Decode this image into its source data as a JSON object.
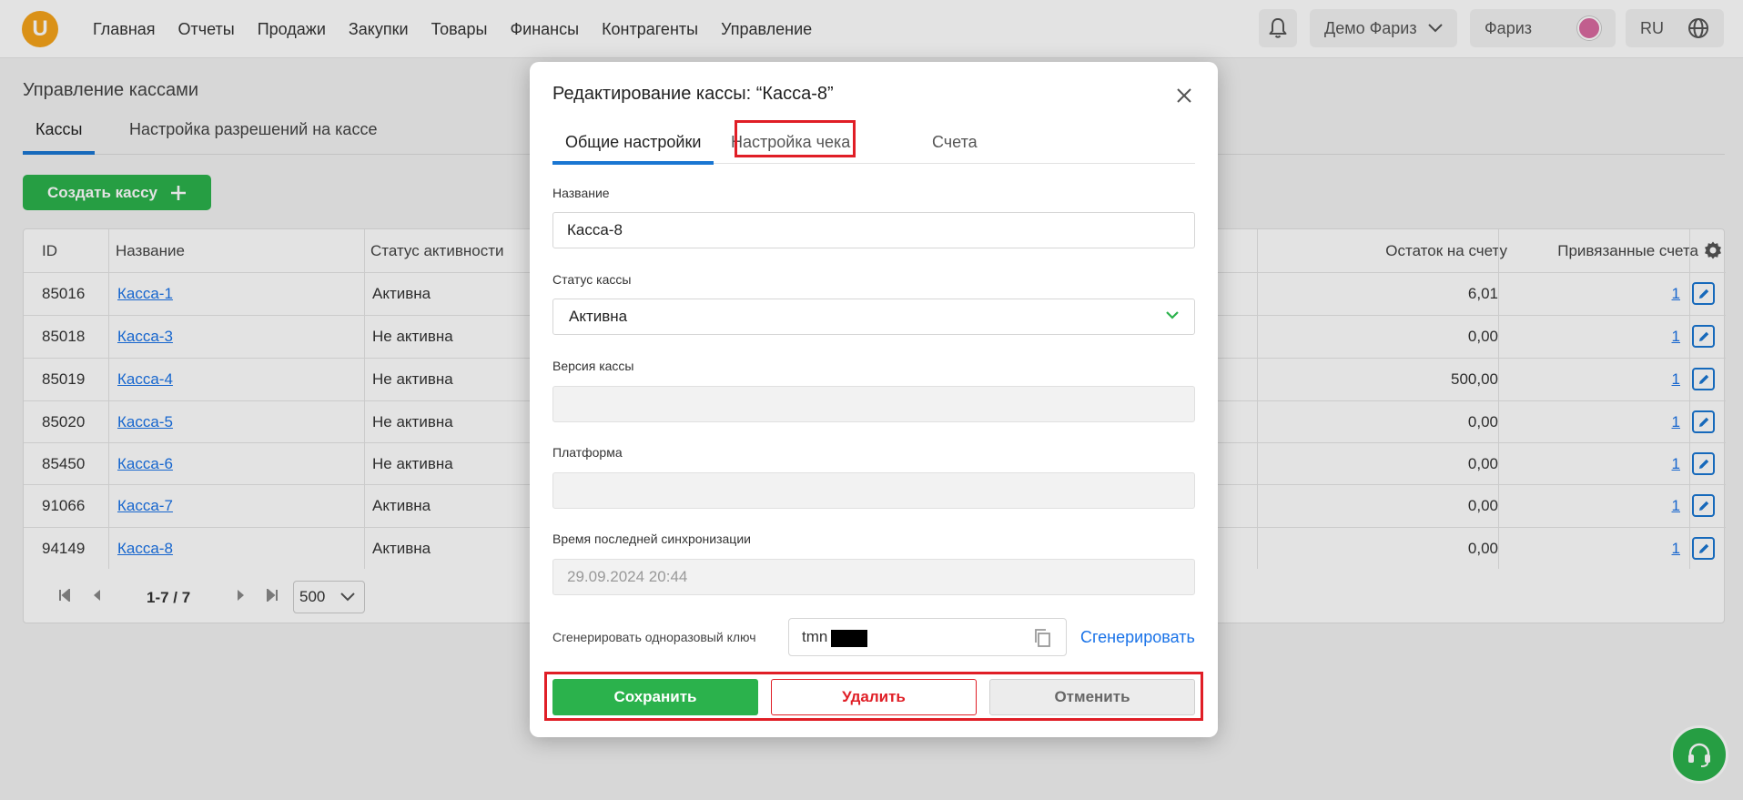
{
  "topbar": {
    "logo_letter": "U",
    "nav": [
      "Главная",
      "Отчеты",
      "Продажи",
      "Закупки",
      "Товары",
      "Финансы",
      "Контрагенты",
      "Управление"
    ],
    "company": "Демо Фариз",
    "user": "Фариз",
    "language": "RU"
  },
  "page": {
    "title": "Управление кассами",
    "tabs": [
      "Кассы",
      "Настройка разрешений на кассе"
    ],
    "create_button": "Создать кассу"
  },
  "table": {
    "headers": {
      "id": "ID",
      "name": "Название",
      "status": "Статус активности",
      "balance": "Остаток на счету",
      "accounts": "Привязанные счета"
    },
    "rows": [
      {
        "id": "85016",
        "name": "Касса-1",
        "status": "Активна",
        "balance": "6,01",
        "accounts": "1"
      },
      {
        "id": "85018",
        "name": "Касса-3",
        "status": "Не активна",
        "balance": "0,00",
        "accounts": "1"
      },
      {
        "id": "85019",
        "name": "Касса-4",
        "status": "Не активна",
        "balance": "500,00",
        "accounts": "1"
      },
      {
        "id": "85020",
        "name": "Касса-5",
        "status": "Не активна",
        "balance": "0,00",
        "accounts": "1"
      },
      {
        "id": "85450",
        "name": "Касса-6",
        "status": "Не активна",
        "balance": "0,00",
        "accounts": "1"
      },
      {
        "id": "91066",
        "name": "Касса-7",
        "status": "Активна",
        "balance": "0,00",
        "accounts": "1"
      },
      {
        "id": "94149",
        "name": "Касса-8",
        "status": "Активна",
        "balance": "0,00",
        "accounts": "1"
      }
    ],
    "pager": {
      "range": "1-7 / 7",
      "page_size": "500"
    }
  },
  "modal": {
    "title": "Редактирование кассы: “Касса-8”",
    "tabs": [
      "Общие настройки",
      "Настройка чека",
      "Счета"
    ],
    "fields": {
      "name_label": "Название",
      "name_value": "Касса-8",
      "status_label": "Статус кассы",
      "status_value": "Активна",
      "version_label": "Версия кассы",
      "version_value": "",
      "platform_label": "Платформа",
      "platform_value": "",
      "sync_label": "Время последней синхронизации",
      "sync_value": "29.09.2024 20:44"
    },
    "key": {
      "label": "Сгенерировать одноразовый ключ",
      "value": "tmn",
      "generate_link": "Сгенерировать"
    },
    "buttons": {
      "save": "Сохранить",
      "delete": "Удалить",
      "cancel": "Отменить"
    },
    "highlight_color": "#e01e26"
  },
  "colors": {
    "accent_green": "#2bb24c",
    "accent_blue": "#1976d2",
    "link": "#1a73e8",
    "danger": "#e01e26"
  }
}
